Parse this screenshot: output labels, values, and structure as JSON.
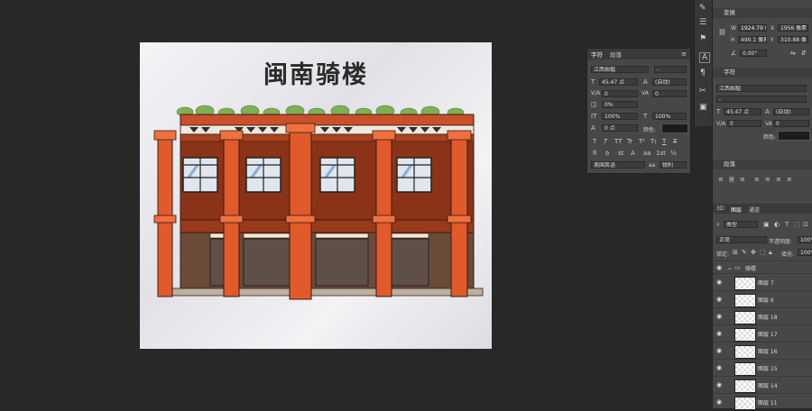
{
  "canvas": {
    "title": "闽南骑楼"
  },
  "char_panel": {
    "tabs": [
      "字符",
      "段落"
    ],
    "font_family": "江西拙楷",
    "font_style": "-",
    "font_size": "45.47 点",
    "leading": "(自动)",
    "kerning": "0",
    "tracking": "0",
    "tsume": "0%",
    "vscale": "100%",
    "hscale": "100%",
    "baseline": "0 点",
    "color_label": "颜色:",
    "type_buttons": [
      "T",
      "T",
      "TT",
      "Tr",
      "T¹",
      "T₁",
      "T",
      "T"
    ],
    "language": "美国英语",
    "aa": "锐利"
  },
  "right_panel": {
    "transform": {
      "header": "变换",
      "w_label": "W",
      "w": "1924.79 像",
      "x_label": "X",
      "x": "1956 像素",
      "h_label": "H",
      "h": "490.1 像素",
      "y_label": "Y",
      "y": "310.88 像",
      "angle": "0.00°"
    },
    "character": {
      "header": "字符",
      "font_family": "江西拙楷",
      "font_style": "-",
      "font_size": "45.47 点",
      "leading": "(自动)",
      "kerning": "0",
      "tracking": "0",
      "color_label": "颜色:"
    },
    "paragraph": {
      "header": "段落"
    },
    "layers": {
      "tabs": [
        "3D",
        "图层",
        "通道"
      ],
      "filter": "类型",
      "blend": "正常",
      "opacity_label": "不透明度:",
      "opacity": "100%",
      "lock_label": "锁定:",
      "fill_label": "填充:",
      "fill": "100%",
      "group": "骑楼",
      "items": [
        "图层 7",
        "图层 6",
        "图层 18",
        "图层 17",
        "图层 16",
        "图层 15",
        "图层 14",
        "图层 11"
      ]
    }
  }
}
